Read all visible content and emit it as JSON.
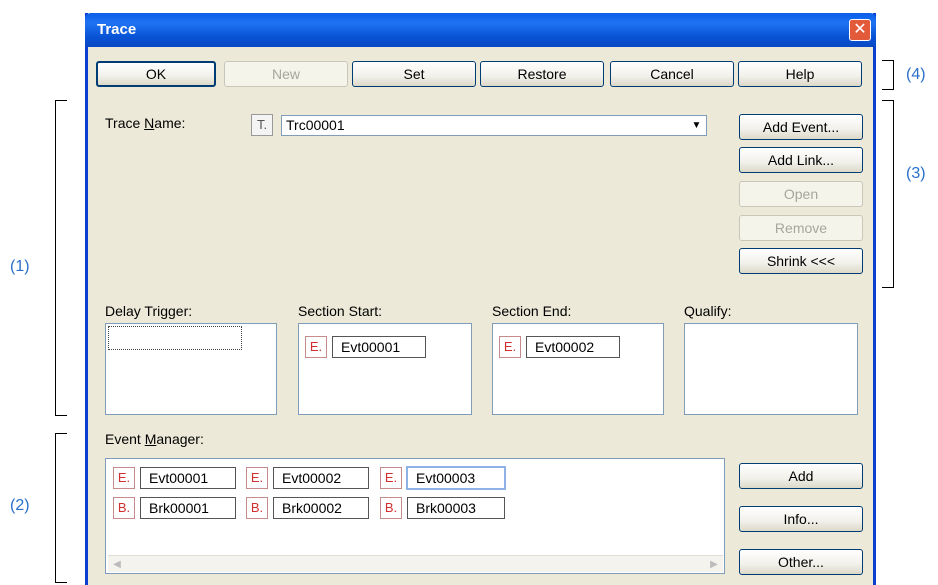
{
  "window": {
    "title": "Trace"
  },
  "toolbar": {
    "ok": "OK",
    "new": "New",
    "set": "Set",
    "restore": "Restore",
    "cancel": "Cancel",
    "help": "Help"
  },
  "trace_name": {
    "label_pre": "Trace ",
    "label_key": "N",
    "label_post": "ame:",
    "tag": "T.",
    "value": "Trc00001"
  },
  "side_buttons": {
    "add_event": "Add Event...",
    "add_link": "Add Link...",
    "open": "Open",
    "remove": "Remove",
    "shrink": "Shrink <<<"
  },
  "conditions": {
    "delay_trigger": {
      "label": "Delay Trigger:"
    },
    "section_start": {
      "label": "Section Start:",
      "tag": "E.",
      "event": "Evt00001"
    },
    "section_end": {
      "label": "Section End:",
      "tag": "E.",
      "event": "Evt00002"
    },
    "qualify": {
      "label": "Qualify:"
    }
  },
  "event_manager": {
    "label": "Event Manager:",
    "row1": [
      {
        "tag": "E.",
        "name": "Evt00001"
      },
      {
        "tag": "E.",
        "name": "Evt00002"
      },
      {
        "tag": "E.",
        "name": "Evt00003"
      }
    ],
    "row2": [
      {
        "tag": "B.",
        "name": "Brk00001"
      },
      {
        "tag": "B.",
        "name": "Brk00002"
      },
      {
        "tag": "B.",
        "name": "Brk00003"
      }
    ],
    "add": "Add",
    "info": "Info...",
    "other": "Other..."
  },
  "annotations": {
    "a1": "(1)",
    "a2": "(2)",
    "a3": "(3)",
    "a4": "(4)"
  },
  "colors": {
    "title_bar": "#0a5ee8",
    "dialog_bg": "#ece9d8",
    "annotation": "#2a6fc9",
    "close_button": "#e35a3a"
  }
}
